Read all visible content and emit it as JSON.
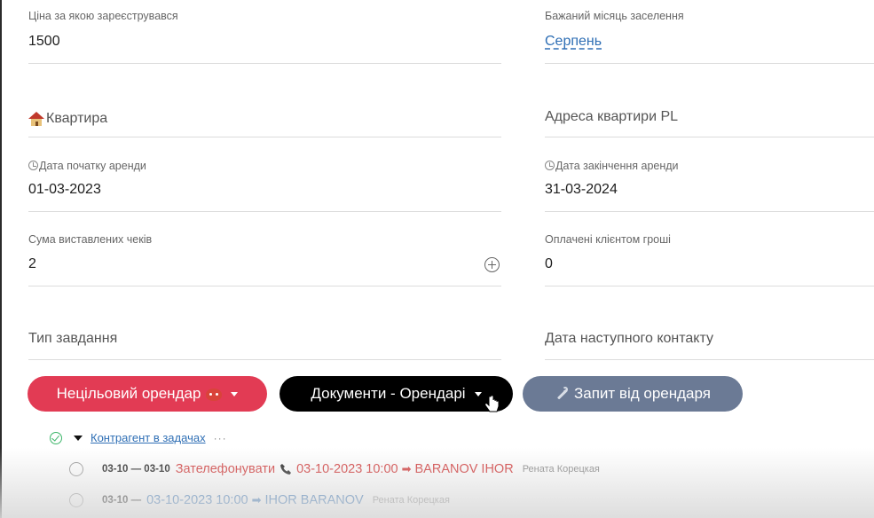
{
  "form": {
    "price_registered": {
      "label": "Ціна за якою зареєструвався",
      "value": "1500"
    },
    "desired_month": {
      "label": "Бажаний місяць заселення",
      "value": "Серпень"
    },
    "apartment": {
      "placeholder": "Квартира",
      "icon": "house-icon"
    },
    "apartment_address": {
      "placeholder": "Адреса квартири PL"
    },
    "rent_start": {
      "label": "Дата початку аренди",
      "value": "01-03-2023",
      "icon": "clock-icon"
    },
    "rent_end": {
      "label": "Дата закінчення аренди",
      "value": "31-03-2024",
      "icon": "clock-icon"
    },
    "invoices_sum": {
      "label": "Сума виставлених чеків",
      "value": "2"
    },
    "paid_by_client": {
      "label": "Оплачені клієнтом гроші",
      "value": "0"
    },
    "task_type": {
      "placeholder": "Тип завдання"
    },
    "next_contact": {
      "placeholder": "Дата наступного контакту"
    }
  },
  "buttons": {
    "non_target": {
      "label": "Нецільовий орендар",
      "color": "#e23b54"
    },
    "documents": {
      "label": "Документи - Орендарі",
      "color": "#000000"
    },
    "request": {
      "label": "Запит від орендаря",
      "color": "#6b7a95"
    }
  },
  "tasks": {
    "title": "Контрагент в задачах",
    "more": "···",
    "items": [
      {
        "date": "03-10 — 03-10",
        "action": "Зателефонувати",
        "datetime": "03-10-2023 10:00",
        "arrow": "➡",
        "contact": "BARANOV IHOR",
        "person": "Рената Корецкая",
        "color": "#d33b3b"
      },
      {
        "date": "03-10 —",
        "action": "",
        "datetime": "03-10-2023 10:00",
        "arrow": "➡",
        "contact": "IHOR BARANOV",
        "person": "Рената Корецкая",
        "color": "#2f6fb5"
      }
    ]
  }
}
